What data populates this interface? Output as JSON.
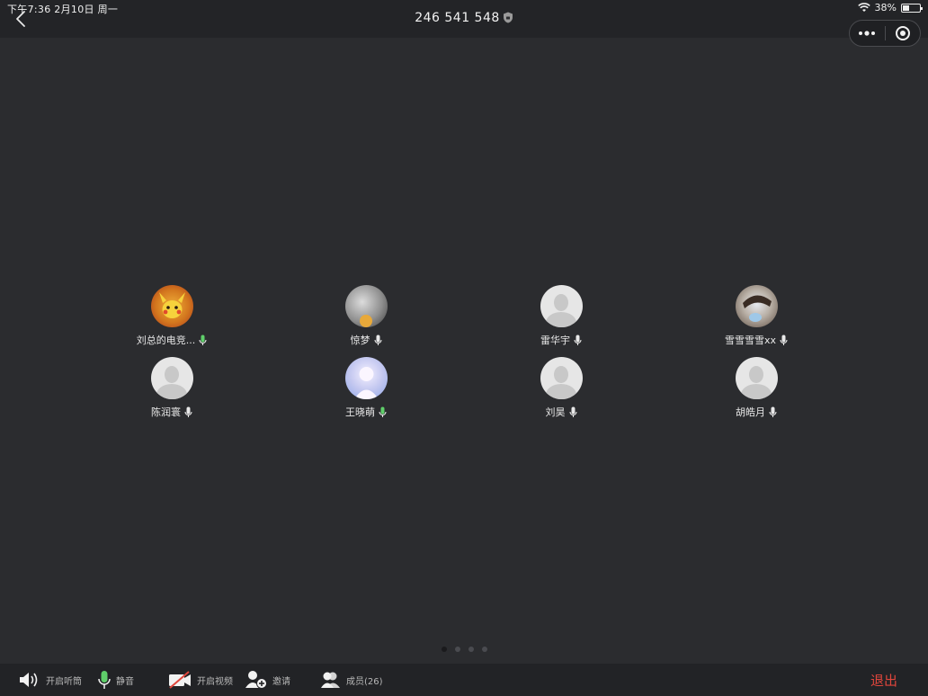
{
  "status_bar": {
    "time": "下午7:36  2月10日 周一",
    "battery": "38%",
    "battery_level": 0.38
  },
  "header": {
    "meeting_id": "246 541 548"
  },
  "participants": [
    {
      "name": "刘总的电竞...",
      "mic": "active"
    },
    {
      "name": "惊梦",
      "mic": "muted"
    },
    {
      "name": "雷华宇",
      "mic": "muted"
    },
    {
      "name": "雪雪雪雪xx",
      "mic": "muted"
    },
    {
      "name": "陈润寰",
      "mic": "muted"
    },
    {
      "name": "王晓萌",
      "mic": "active"
    },
    {
      "name": "刘昊",
      "mic": "muted"
    },
    {
      "name": "胡皓月",
      "mic": "muted"
    }
  ],
  "pagination": {
    "pages": 4,
    "current": 1
  },
  "toolbar": {
    "speaker_label": "开启听筒",
    "mute_label": "静音",
    "video_label": "开启视频",
    "invite_label": "邀请",
    "members_label": "成员(26)",
    "exit_label": "退出"
  },
  "colors": {
    "background": "#2b2c2f",
    "exit": "#e0463c",
    "mic_active": "#5fcf6a"
  }
}
